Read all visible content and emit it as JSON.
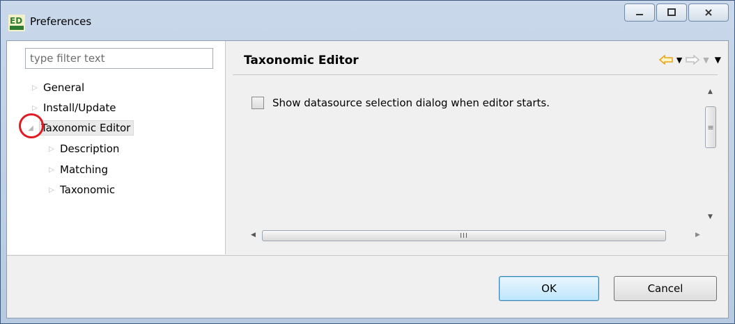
{
  "window": {
    "title": "Preferences",
    "app_icon_text": "ED"
  },
  "filter": {
    "placeholder": "type filter text",
    "value": ""
  },
  "tree": [
    {
      "label": "General",
      "expanded": false,
      "selected": false,
      "level": 0
    },
    {
      "label": "Install/Update",
      "expanded": false,
      "selected": false,
      "level": 0
    },
    {
      "label": "Taxonomic Editor",
      "expanded": true,
      "selected": true,
      "level": 0
    },
    {
      "label": "Description",
      "expanded": false,
      "selected": false,
      "level": 1
    },
    {
      "label": "Matching",
      "expanded": false,
      "selected": false,
      "level": 1
    },
    {
      "label": "Taxonomic",
      "expanded": false,
      "selected": false,
      "level": 1
    }
  ],
  "page": {
    "title": "Taxonomic Editor",
    "checkbox_label": "Show datasource selection dialog when editor starts.",
    "checkbox_checked": false
  },
  "buttons": {
    "ok": "OK",
    "cancel": "Cancel"
  },
  "colors": {
    "highlight_circle": "#e01b24",
    "nav_back_arrow": "#e8a317"
  }
}
